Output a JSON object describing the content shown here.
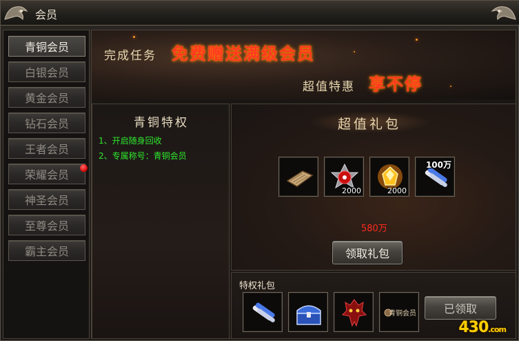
{
  "window": {
    "title": "会员"
  },
  "sidebar": {
    "items": [
      {
        "label": "青铜会员",
        "active": true
      },
      {
        "label": "白银会员",
        "active": false
      },
      {
        "label": "黄金会员",
        "active": false
      },
      {
        "label": "钻石会员",
        "active": false
      },
      {
        "label": "王者会员",
        "active": false
      },
      {
        "label": "荣耀会员",
        "active": false,
        "notification": true
      },
      {
        "label": "神圣会员",
        "active": false
      },
      {
        "label": "至尊会员",
        "active": false
      },
      {
        "label": "霸主会员",
        "active": false
      }
    ]
  },
  "banner": {
    "line1_prefix": "完成任务",
    "line1_highlight": "免费赠送满级会员",
    "line2_prefix": "超值特惠",
    "line2_highlight": "享不停"
  },
  "privileges": {
    "title": "青铜特权",
    "items": [
      "1、开启随身回收",
      "2、专属称号：青铜会员"
    ]
  },
  "gift_pack": {
    "title": "超值礼包",
    "items": [
      {
        "icon": "scroll-paper-icon",
        "count": ""
      },
      {
        "icon": "red-demon-emblem-icon",
        "count": "2000"
      },
      {
        "icon": "gold-gem-icon",
        "count": "2000"
      },
      {
        "icon": "blue-scroll-bundle-icon",
        "count": "100万"
      }
    ],
    "gold_amount": "580万",
    "claim_button": "领取礼包"
  },
  "privilege_pack": {
    "title": "特权礼包",
    "items": [
      {
        "icon": "blue-scroll-bundle-icon"
      },
      {
        "icon": "blue-treasure-chest-icon"
      },
      {
        "icon": "red-demon-mask-icon"
      },
      {
        "icon": "bronze-title-badge-icon",
        "text": "青铜会员"
      }
    ],
    "claimed_button": "已领取"
  },
  "watermark": {
    "text": "430",
    "suffix": ".com"
  },
  "colors": {
    "accent_red": "#ff3a20",
    "privilege_green": "#2ee82e",
    "gold_red": "#ff2a20",
    "notification_dot": "#d40000"
  }
}
